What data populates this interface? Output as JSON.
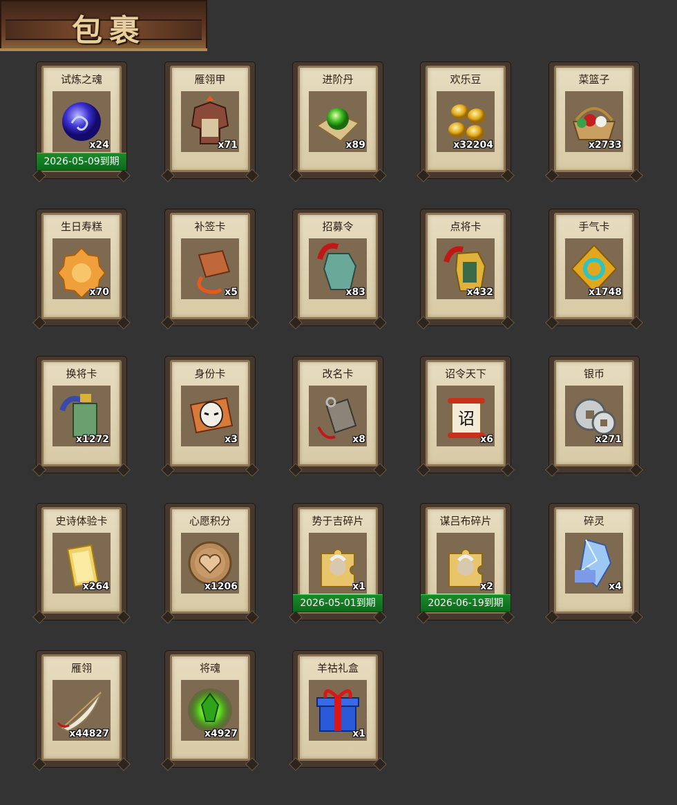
{
  "header": {
    "title": "包裹"
  },
  "items": [
    {
      "name": "试炼之魂",
      "qty": "x24",
      "expiry": "2026-05-09到期",
      "icon": "blue-dragon-orb-icon"
    },
    {
      "name": "雁翎甲",
      "qty": "x71",
      "expiry": "",
      "icon": "armor-icon"
    },
    {
      "name": "进阶丹",
      "qty": "x89",
      "expiry": "",
      "icon": "green-pill-icon"
    },
    {
      "name": "欢乐豆",
      "qty": "x32204",
      "expiry": "",
      "icon": "gold-beans-icon"
    },
    {
      "name": "菜篮子",
      "qty": "x2733",
      "expiry": "",
      "icon": "basket-icon"
    },
    {
      "name": "生日寿糕",
      "qty": "x70",
      "expiry": "",
      "icon": "birthday-cake-icon"
    },
    {
      "name": "补签卡",
      "qty": "x5",
      "expiry": "",
      "icon": "bronze-token-icon"
    },
    {
      "name": "招募令",
      "qty": "x83",
      "expiry": "",
      "icon": "recruit-token-icon"
    },
    {
      "name": "点将卡",
      "qty": "x432",
      "expiry": "",
      "icon": "general-card-icon"
    },
    {
      "name": "手气卡",
      "qty": "x1748",
      "expiry": "",
      "icon": "luck-card-icon"
    },
    {
      "name": "换将卡",
      "qty": "x1272",
      "expiry": "",
      "icon": "swap-card-icon"
    },
    {
      "name": "身份卡",
      "qty": "x3",
      "expiry": "",
      "icon": "identity-mask-icon"
    },
    {
      "name": "改名卡",
      "qty": "x8",
      "expiry": "",
      "icon": "rename-tag-icon"
    },
    {
      "name": "诏令天下",
      "qty": "x6",
      "expiry": "",
      "icon": "edict-scroll-icon"
    },
    {
      "name": "银币",
      "qty": "x271",
      "expiry": "",
      "icon": "silver-coins-icon"
    },
    {
      "name": "史诗体验卡",
      "qty": "x264",
      "expiry": "",
      "icon": "gold-card-icon"
    },
    {
      "name": "心愿积分",
      "qty": "x1206",
      "expiry": "",
      "icon": "heart-coin-icon"
    },
    {
      "name": "势于吉碎片",
      "qty": "x1",
      "expiry": "2026-05-01到期",
      "icon": "puzzle-fragment-icon"
    },
    {
      "name": "谋吕布碎片",
      "qty": "x2",
      "expiry": "2026-06-19到期",
      "icon": "puzzle-fragment-icon"
    },
    {
      "name": "碎灵",
      "qty": "x4",
      "expiry": "",
      "icon": "crystal-shard-icon"
    },
    {
      "name": "雁翎",
      "qty": "x44827",
      "expiry": "",
      "icon": "feather-icon"
    },
    {
      "name": "将魂",
      "qty": "x4927",
      "expiry": "",
      "icon": "green-soul-gem-icon"
    },
    {
      "name": "羊祜礼盒",
      "qty": "x1",
      "expiry": "",
      "icon": "gift-box-icon"
    }
  ]
}
